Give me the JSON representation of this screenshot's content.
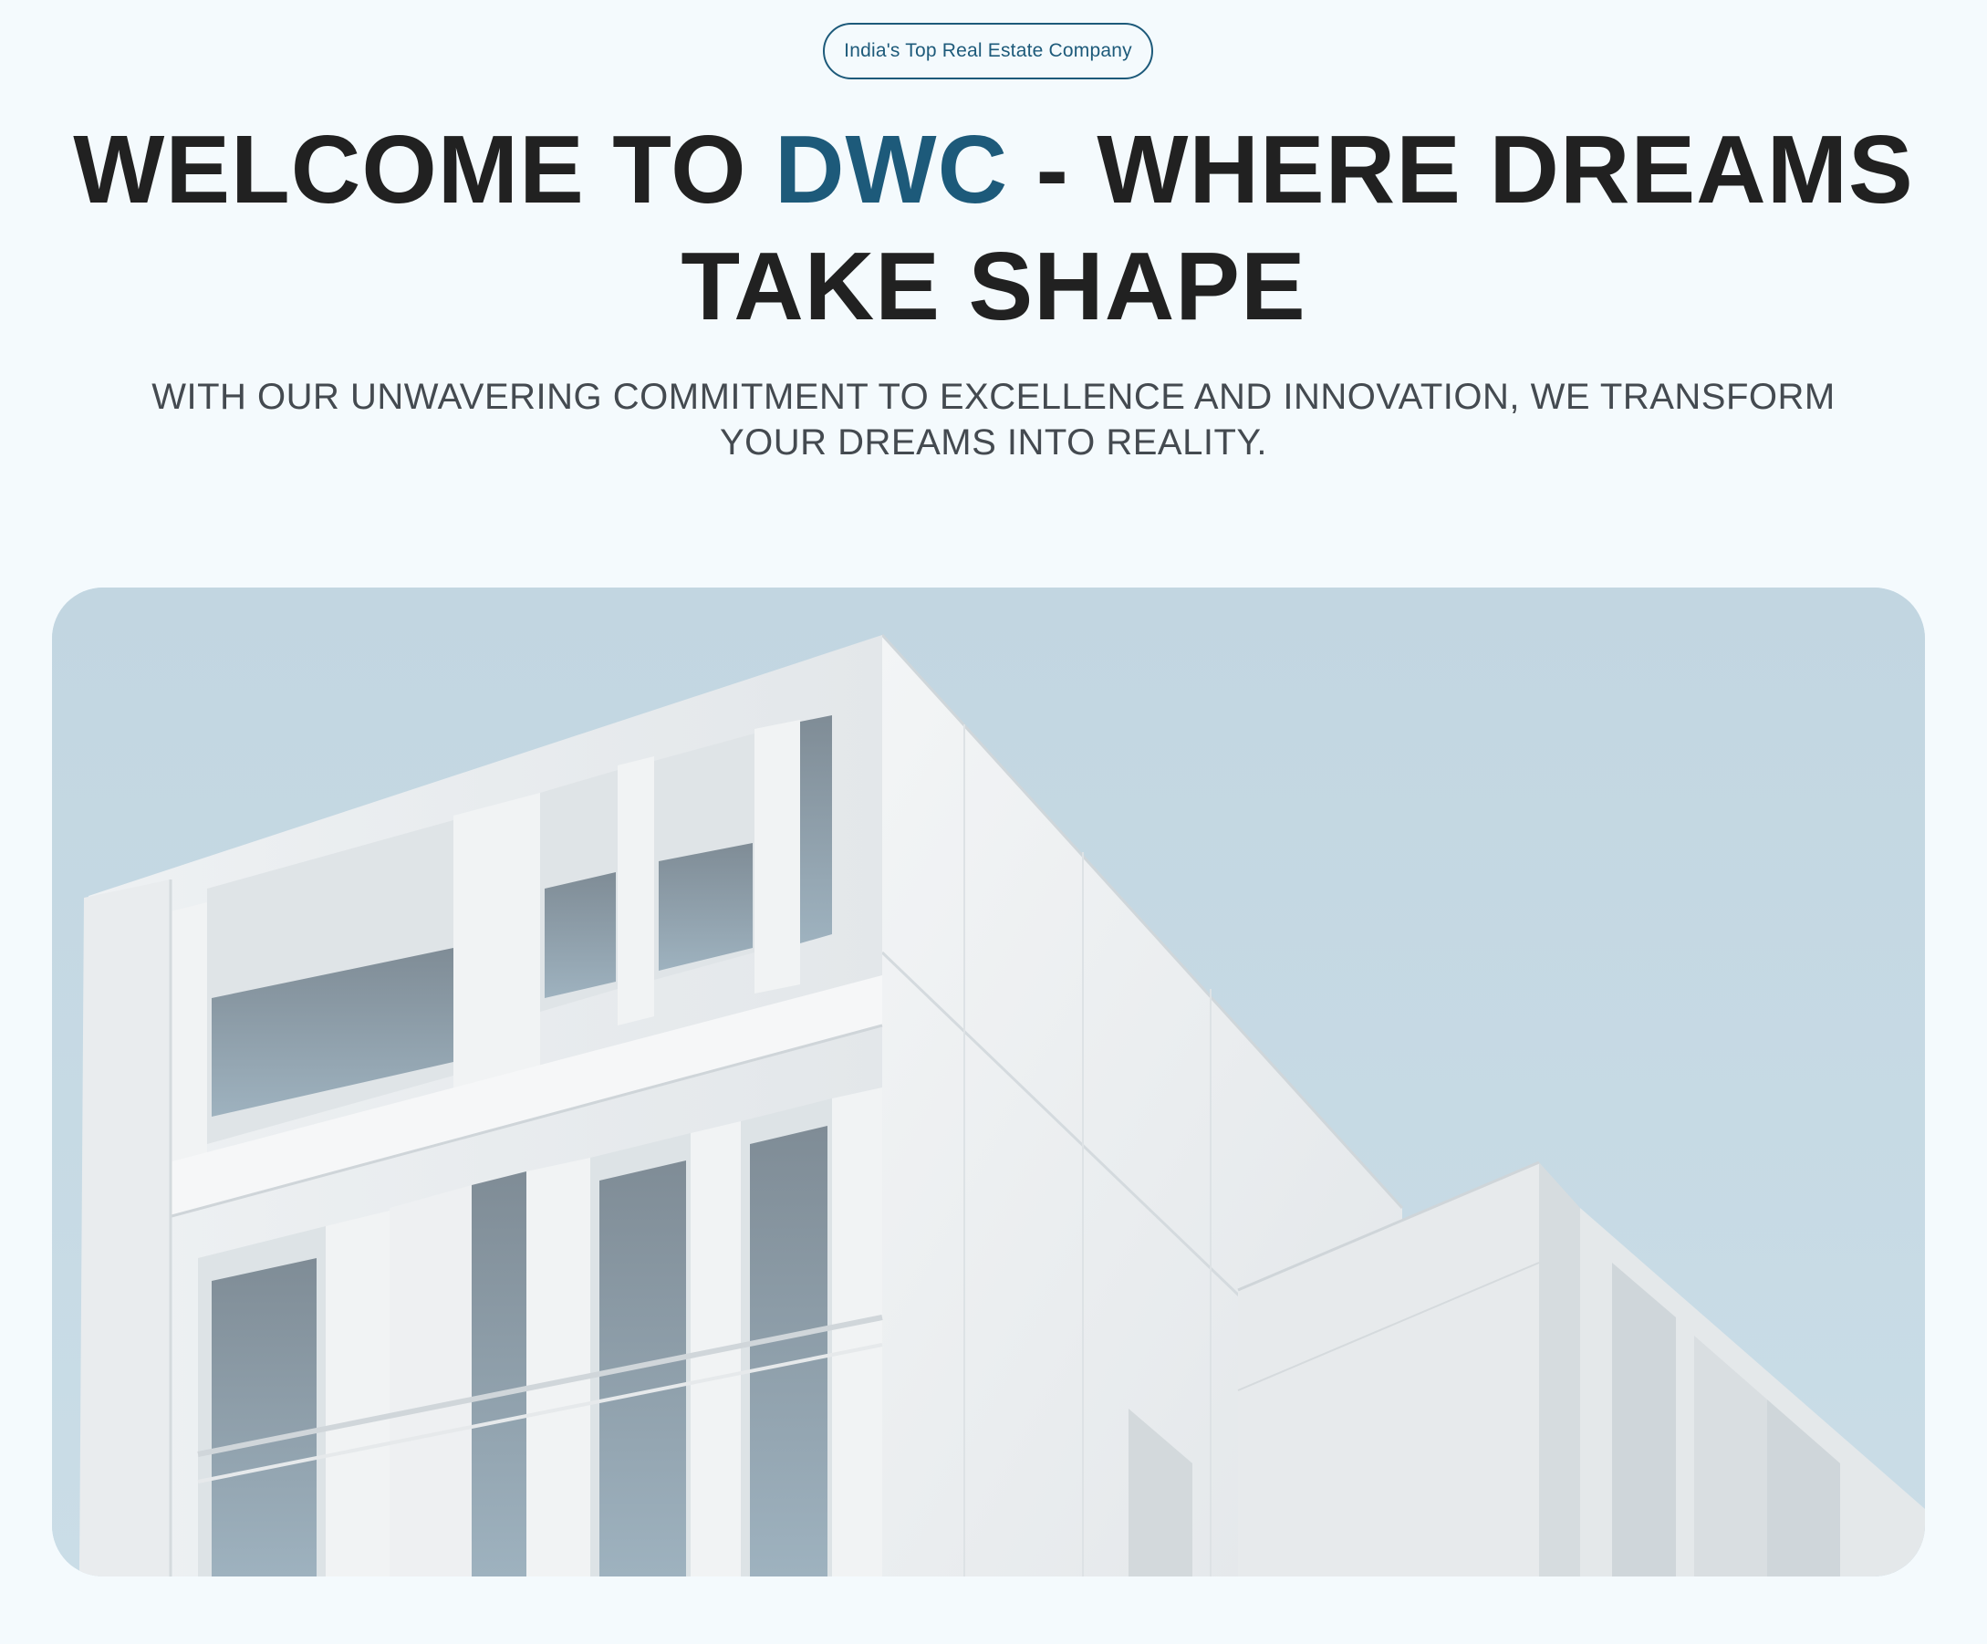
{
  "hero": {
    "badge": "India's Top Real Estate Company",
    "title_prefix": "WELCOME TO ",
    "title_brand": "DWC",
    "title_suffix": " - WHERE DREAMS TAKE SHAPE",
    "subtitle": "WITH OUR UNWAVERING COMMITMENT TO EXCELLENCE AND INNOVATION, WE TRANSFORM YOUR DREAMS INTO REALITY."
  },
  "colors": {
    "background": "#f4fafd",
    "brand_accent": "#1d5a7a",
    "heading": "#212121",
    "subtitle": "#444a50",
    "sky": "#c6d9e3"
  },
  "image": {
    "subject": "building-photo"
  }
}
